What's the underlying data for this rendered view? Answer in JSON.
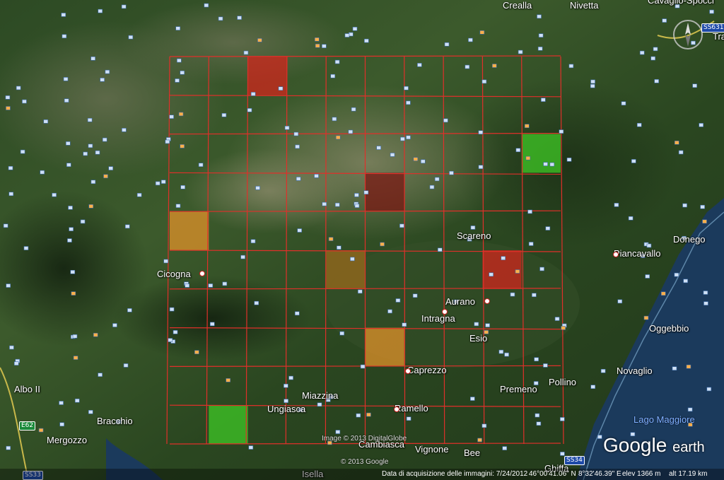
{
  "places": [
    {
      "name": "Crealla"
    },
    {
      "name": "Nivetta"
    },
    {
      "name": "Cavaglio-Spocci"
    },
    {
      "name": "Scareno"
    },
    {
      "name": "Donego"
    },
    {
      "name": "Piancavallo"
    },
    {
      "name": "Cicogna"
    },
    {
      "name": "Aurano"
    },
    {
      "name": "Intragna"
    },
    {
      "name": "Oggebbio"
    },
    {
      "name": "Esio"
    },
    {
      "name": "Caprezzo"
    },
    {
      "name": "Novaglio"
    },
    {
      "name": "Albo II"
    },
    {
      "name": "Miazzina"
    },
    {
      "name": "Premeno"
    },
    {
      "name": "Pollino"
    },
    {
      "name": "Ungiasca"
    },
    {
      "name": "Ramello"
    },
    {
      "name": "Bracchio"
    },
    {
      "name": "Mergozzo"
    },
    {
      "name": "Cambiasca"
    },
    {
      "name": "Vignone"
    },
    {
      "name": "Bee"
    },
    {
      "name": "Ghiffa"
    },
    {
      "name": "Isella"
    },
    {
      "name": "Tra"
    }
  ],
  "water_label": "Lago Maggiore",
  "roads": [
    "SS631",
    "E62",
    "SS33",
    "SS34"
  ],
  "imagery_credit": "Image © 2013 DigitalGlobe",
  "map_credit": "© 2013 Google",
  "status_bar": {
    "acquisition": "Data di acquisizione delle immagini: 7/24/2012",
    "lat": "46°00'41.06\" N",
    "lon": "8°32'46.39\" E",
    "elev": "elev  1366 m",
    "alt": "alt  17.19 km"
  },
  "logo": {
    "google": "Google",
    "earth": "earth"
  },
  "grid": {
    "rows": 10,
    "cols": 10,
    "line_color": "#e0302a",
    "highlighted_cells": [
      {
        "row": 0,
        "col": 2,
        "status": "red"
      },
      {
        "row": 2,
        "col": 9,
        "status": "green"
      },
      {
        "row": 4,
        "col": 0,
        "status": "orange"
      },
      {
        "row": 3,
        "col": 5,
        "status": "dark-red"
      },
      {
        "row": 5,
        "col": 4,
        "status": "dark-orange"
      },
      {
        "row": 5,
        "col": 8,
        "status": "red"
      },
      {
        "row": 7,
        "col": 5,
        "status": "orange"
      },
      {
        "row": 9,
        "col": 1,
        "status": "green"
      }
    ],
    "status_colors": {
      "red": "#d0261c",
      "dark-red": "#7a1a14",
      "green": "#3fc826",
      "orange": "#e0922a",
      "dark-orange": "#9a6a1c"
    }
  },
  "icons": [
    "compass-icon",
    "photo-marker-icon",
    "place-dot-icon"
  ]
}
